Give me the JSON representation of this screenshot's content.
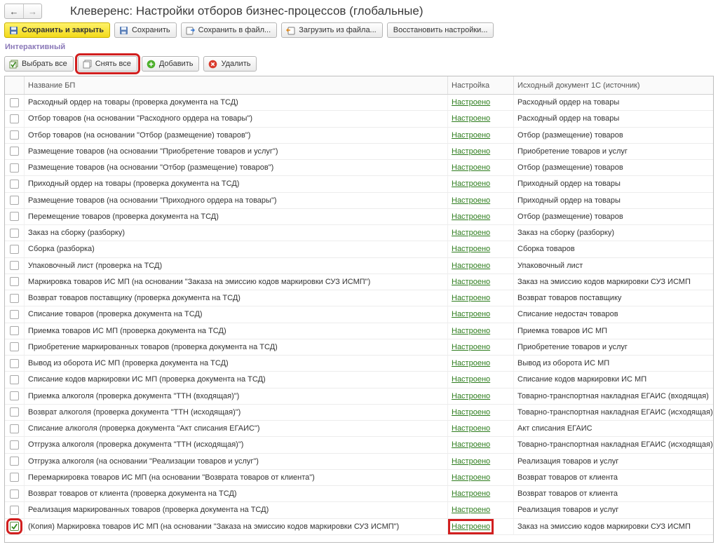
{
  "window": {
    "title": "Клеверенс: Настройки отборов бизнес-процессов (глобальные)",
    "back_glyph": "←",
    "forward_glyph": "→"
  },
  "toolbar": {
    "save_close": "Сохранить и закрыть",
    "save": "Сохранить",
    "save_file": "Сохранить в файл...",
    "load_file": "Загрузить из файла...",
    "restore": "Восстановить настройки..."
  },
  "section": {
    "label": "Интерактивный"
  },
  "commands": {
    "select_all": "Выбрать все",
    "deselect_all": "Снять все",
    "add": "Добавить",
    "delete": "Удалить"
  },
  "table": {
    "headers": {
      "name": "Название БП",
      "setting": "Настройка",
      "source": "Исходный документ 1С (источник)"
    },
    "rows": [
      {
        "checked": false,
        "name": "Расходный ордер на товары (проверка документа на ТСД)",
        "setting": "Настроено",
        "source": "Расходный ордер на товары"
      },
      {
        "checked": false,
        "name": "Отбор товаров (на основании \"Расходного ордера на товары\")",
        "setting": "Настроено",
        "source": "Расходный ордер на товары"
      },
      {
        "checked": false,
        "name": "Отбор товаров (на основании \"Отбор (размещение) товаров\")",
        "setting": "Настроено",
        "source": "Отбор (размещение) товаров"
      },
      {
        "checked": false,
        "name": "Размещение товаров (на основании \"Приобретение товаров и услуг\")",
        "setting": "Настроено",
        "source": "Приобретение товаров и услуг"
      },
      {
        "checked": false,
        "name": "Размещение товаров (на основании \"Отбор (размещение) товаров\")",
        "setting": "Настроено",
        "source": "Отбор (размещение) товаров"
      },
      {
        "checked": false,
        "name": "Приходный ордер на товары (проверка документа на ТСД)",
        "setting": "Настроено",
        "source": "Приходный ордер на товары"
      },
      {
        "checked": false,
        "name": "Размещение товаров (на основании \"Приходного ордера на товары\")",
        "setting": "Настроено",
        "source": "Приходный ордер на товары"
      },
      {
        "checked": false,
        "name": "Перемещение товаров (проверка документа на ТСД)",
        "setting": "Настроено",
        "source": "Отбор (размещение) товаров"
      },
      {
        "checked": false,
        "name": "Заказ на сборку (разборку)",
        "setting": "Настроено",
        "source": "Заказ на сборку (разборку)"
      },
      {
        "checked": false,
        "name": "Сборка (разборка)",
        "setting": "Настроено",
        "source": "Сборка товаров"
      },
      {
        "checked": false,
        "name": "Упаковочный лист (проверка на ТСД)",
        "setting": "Настроено",
        "source": "Упаковочный лист"
      },
      {
        "checked": false,
        "name": "Маркировка товаров ИС МП (на основании \"Заказа на эмиссию кодов маркировки СУЗ ИСМП\")",
        "setting": "Настроено",
        "source": "Заказ на эмиссию кодов маркировки СУЗ ИСМП"
      },
      {
        "checked": false,
        "name": "Возврат товаров поставщику (проверка документа на ТСД)",
        "setting": "Настроено",
        "source": "Возврат товаров поставщику"
      },
      {
        "checked": false,
        "name": "Списание товаров (проверка документа на ТСД)",
        "setting": "Настроено",
        "source": "Списание недостач товаров"
      },
      {
        "checked": false,
        "name": "Приемка товаров ИС МП (проверка документа на ТСД)",
        "setting": "Настроено",
        "source": "Приемка товаров ИС МП"
      },
      {
        "checked": false,
        "name": "Приобретение маркированных товаров (проверка документа на ТСД)",
        "setting": "Настроено",
        "source": "Приобретение товаров и услуг"
      },
      {
        "checked": false,
        "name": "Вывод из оборота ИС МП (проверка документа на ТСД)",
        "setting": "Настроено",
        "source": "Вывод из оборота ИС МП"
      },
      {
        "checked": false,
        "name": "Списание кодов маркировки ИС МП (проверка документа на ТСД)",
        "setting": "Настроено",
        "source": "Списание кодов маркировки ИС МП"
      },
      {
        "checked": false,
        "name": "Приемка алкоголя (проверка документа \"ТТН (входящая)\")",
        "setting": "Настроено",
        "source": "Товарно-транспортная накладная ЕГАИС (входящая)"
      },
      {
        "checked": false,
        "name": "Возврат алкоголя (проверка документа \"ТТН (исходящая)\")",
        "setting": "Настроено",
        "source": "Товарно-транспортная накладная ЕГАИС (исходящая)"
      },
      {
        "checked": false,
        "name": "Списание алкоголя (проверка документа \"Акт списания ЕГАИС\")",
        "setting": "Настроено",
        "source": "Акт списания ЕГАИС"
      },
      {
        "checked": false,
        "name": "Отгрузка алкоголя (проверка документа \"ТТН (исходящая)\")",
        "setting": "Настроено",
        "source": "Товарно-транспортная накладная ЕГАИС (исходящая)"
      },
      {
        "checked": false,
        "name": "Отгрузка алкоголя (на основании \"Реализации товаров и услуг\")",
        "setting": "Настроено",
        "source": "Реализация товаров и услуг"
      },
      {
        "checked": false,
        "name": "Перемаркировка товаров ИС МП (на основании \"Возврата товаров от клиента\")",
        "setting": "Настроено",
        "source": "Возврат товаров от клиента"
      },
      {
        "checked": false,
        "name": "Возврат товаров от клиента (проверка документа на ТСД)",
        "setting": "Настроено",
        "source": "Возврат товаров от клиента"
      },
      {
        "checked": false,
        "name": "Реализация маркированных товаров (проверка документа на ТСД)",
        "setting": "Настроено",
        "source": "Реализация товаров и услуг"
      },
      {
        "checked": true,
        "name": "(Копия) Маркировка товаров ИС МП (на основании \"Заказа на эмиссию кодов маркировки СУЗ ИСМП\")",
        "setting": "Настроено",
        "source": "Заказ на эмиссию кодов маркировки СУЗ ИСМП"
      }
    ]
  }
}
